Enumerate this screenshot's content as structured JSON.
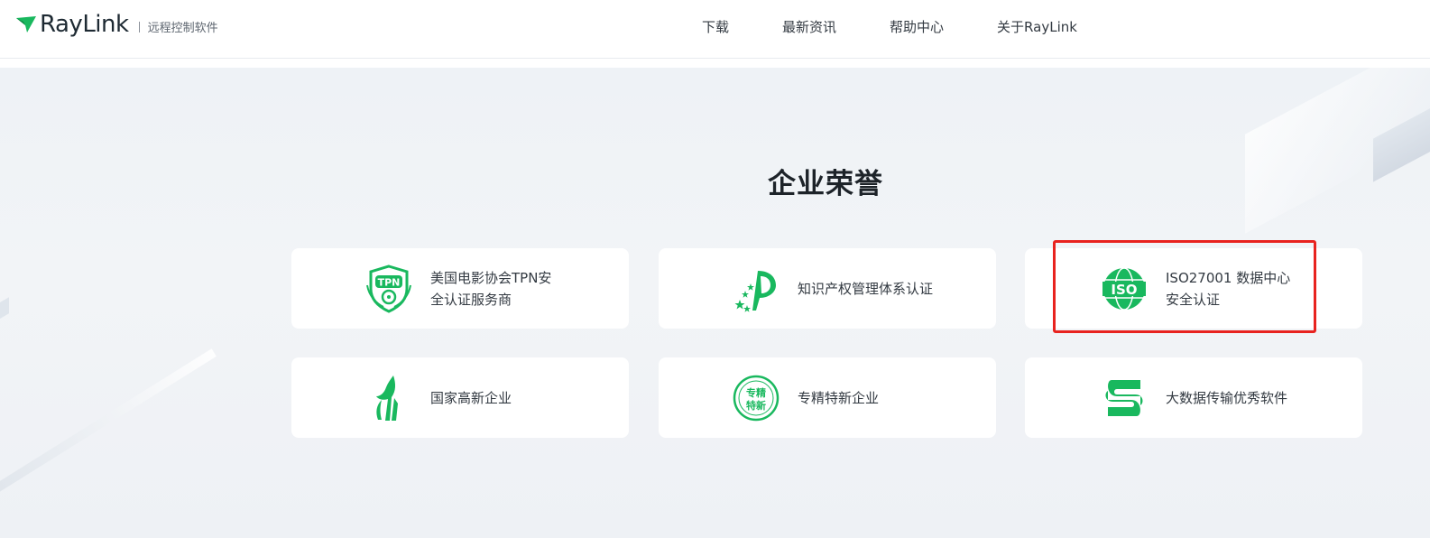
{
  "header": {
    "logo_text": "RayLink",
    "logo_subtitle": "远程控制软件",
    "nav": [
      "下载",
      "最新资讯",
      "帮助中心",
      "关于RayLink"
    ]
  },
  "section": {
    "title": "企业荣誉"
  },
  "honors": [
    {
      "label": "美国电影协会TPN安\n全认证服务商",
      "icon": "tpn-shield-icon"
    },
    {
      "label": "知识产权管理体系认证",
      "icon": "ip-certification-icon"
    },
    {
      "label": "ISO27001 数据中心\n安全认证",
      "icon": "iso-globe-icon"
    },
    {
      "label": "国家高新企业",
      "icon": "high-tech-flame-icon"
    },
    {
      "label": "专精特新企业",
      "icon": "specialized-badge-icon"
    },
    {
      "label": "大数据传输优秀软件",
      "icon": "data-transfer-icon"
    }
  ],
  "badge_texts": {
    "tpn": "TPN",
    "iso": "ISO",
    "spec_top": "专精",
    "spec_bottom": "特新"
  },
  "colors": {
    "brand_green": "#19b85e",
    "highlight": "#e8231f"
  }
}
